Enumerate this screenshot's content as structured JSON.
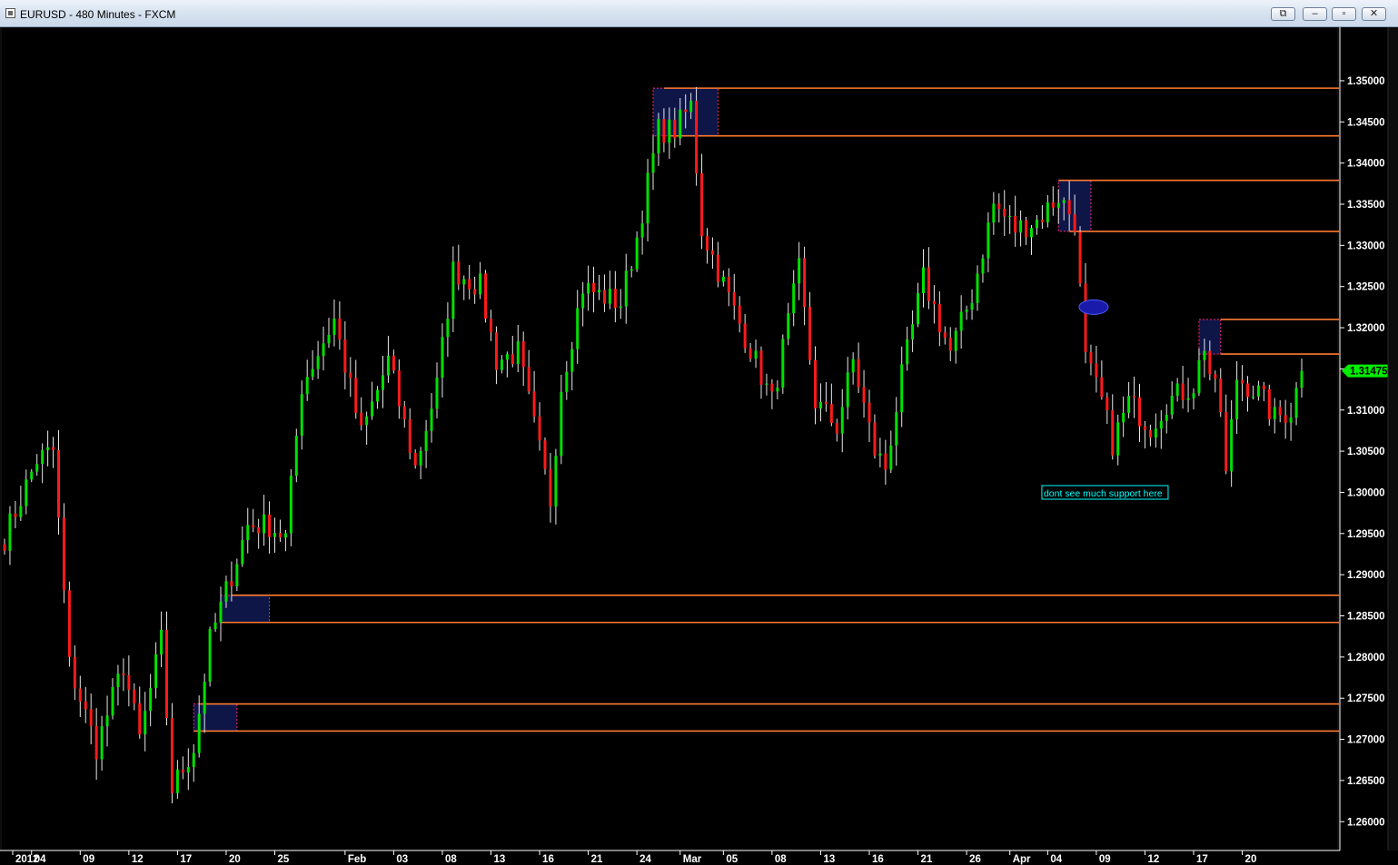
{
  "window": {
    "title": "EURUSD - 480 Minutes - FXCM",
    "buttons": {
      "restore_panel": "⧉",
      "minimize": "–",
      "maximize": "▫",
      "close": "✕"
    }
  },
  "colors": {
    "background": "#000000",
    "up_candle": "#00e000",
    "down_candle": "#ff1a1a",
    "wick": "#e8e8e8",
    "level_line": "#ff7a30",
    "zone_border": "#ff2a6a",
    "zone_fill": "#101850",
    "axis_text": "#ffffff",
    "price_tag_bg": "#00ee00",
    "note_text": "#00ffff",
    "marker": "#1a1aaa"
  },
  "chart_data": {
    "type": "candlestick",
    "symbol": "EURUSD",
    "timeframe": "480 Minutes",
    "broker": "FXCM",
    "ylim": [
      1.2565,
      1.3565
    ],
    "y_ticks": [
      "1.35000",
      "1.34500",
      "1.34000",
      "1.33500",
      "1.33000",
      "1.32500",
      "1.32000",
      "1.31500",
      "1.31000",
      "1.30500",
      "1.30000",
      "1.29500",
      "1.29000",
      "1.28500",
      "1.28000",
      "1.27500",
      "1.27000",
      "1.26500",
      "1.26000"
    ],
    "x_labels": [
      "2012",
      "04",
      "09",
      "12",
      "17",
      "20",
      "25",
      "Feb",
      "03",
      "08",
      "13",
      "16",
      "21",
      "24",
      "Mar",
      "05",
      "08",
      "13",
      "16",
      "21",
      "26",
      "Apr",
      "04",
      "09",
      "12",
      "17",
      "20"
    ],
    "x_label_bars": [
      0,
      5,
      14,
      23,
      32,
      41,
      50,
      63,
      72,
      81,
      90,
      99,
      108,
      117,
      125,
      133,
      142,
      151,
      160,
      169,
      178,
      186,
      193,
      202,
      211,
      220,
      229
    ],
    "bar_count": 241,
    "current_price": "1.31475",
    "price_path": [
      [
        0,
        1.2945
      ],
      [
        6,
        1.304
      ],
      [
        9,
        1.305
      ],
      [
        12,
        1.279
      ],
      [
        17,
        1.269
      ],
      [
        22,
        1.279
      ],
      [
        25,
        1.27
      ],
      [
        29,
        1.282
      ],
      [
        31,
        1.264
      ],
      [
        35,
        1.269
      ],
      [
        38,
        1.282
      ],
      [
        45,
        1.296
      ],
      [
        49,
        1.296
      ],
      [
        52,
        1.2945
      ],
      [
        55,
        1.313
      ],
      [
        61,
        1.321
      ],
      [
        66,
        1.307
      ],
      [
        71,
        1.316
      ],
      [
        76,
        1.303
      ],
      [
        80,
        1.313
      ],
      [
        83,
        1.327
      ],
      [
        88,
        1.325
      ],
      [
        91,
        1.316
      ],
      [
        95,
        1.317
      ],
      [
        99,
        1.305
      ],
      [
        101,
        1.299
      ],
      [
        103,
        1.313
      ],
      [
        107,
        1.325
      ],
      [
        110,
        1.324
      ],
      [
        114,
        1.323
      ],
      [
        117,
        1.331
      ],
      [
        121,
        1.344
      ],
      [
        124,
        1.344
      ],
      [
        127,
        1.347
      ],
      [
        129,
        1.332
      ],
      [
        132,
        1.327
      ],
      [
        135,
        1.322
      ],
      [
        138,
        1.3175
      ],
      [
        142,
        1.311
      ],
      [
        147,
        1.327
      ],
      [
        150,
        1.311
      ],
      [
        154,
        1.308
      ],
      [
        157,
        1.316
      ],
      [
        161,
        1.305
      ],
      [
        163,
        1.303
      ],
      [
        166,
        1.314
      ],
      [
        170,
        1.326
      ],
      [
        175,
        1.317
      ],
      [
        179,
        1.324
      ],
      [
        183,
        1.335
      ],
      [
        187,
        1.332
      ],
      [
        191,
        1.333
      ],
      [
        195,
        1.336
      ],
      [
        198,
        1.333
      ],
      [
        199,
        1.3245
      ],
      [
        200,
        1.316
      ],
      [
        203,
        1.311
      ],
      [
        205,
        1.306
      ],
      [
        208,
        1.311
      ],
      [
        212,
        1.308
      ],
      [
        215,
        1.311
      ],
      [
        220,
        1.313
      ],
      [
        222,
        1.318
      ],
      [
        223,
        1.3145
      ],
      [
        225,
        1.31
      ],
      [
        226,
        1.302
      ],
      [
        228,
        1.314
      ],
      [
        232,
        1.312
      ],
      [
        235,
        1.309
      ],
      [
        238,
        1.31
      ],
      [
        240,
        1.31475
      ]
    ],
    "levels": [
      "1.34910",
      "1.34330",
      "1.33790",
      "1.33170",
      "1.32100",
      "1.31680",
      "1.28750",
      "1.28420",
      "1.27430",
      "1.27100"
    ],
    "zones": [
      {
        "bar_start": 120,
        "bar_end": 132,
        "top": 1.3491,
        "bottom": 1.3433
      },
      {
        "bar_start": 195,
        "bar_end": 201,
        "top": 1.3379,
        "bottom": 1.3317
      },
      {
        "bar_start": 221,
        "bar_end": 225,
        "top": 1.321,
        "bottom": 1.3168
      },
      {
        "bar_start": 40,
        "bar_end": 49,
        "top": 1.2875,
        "bottom": 1.2842
      },
      {
        "bar_start": 35,
        "bar_end": 43,
        "top": 1.2743,
        "bottom": 1.271
      }
    ],
    "marker": {
      "bar": 201,
      "price": 1.3225
    },
    "annotations": [
      {
        "text": "dont see much support here",
        "bar": 201,
        "price": 1.2995
      }
    ]
  }
}
